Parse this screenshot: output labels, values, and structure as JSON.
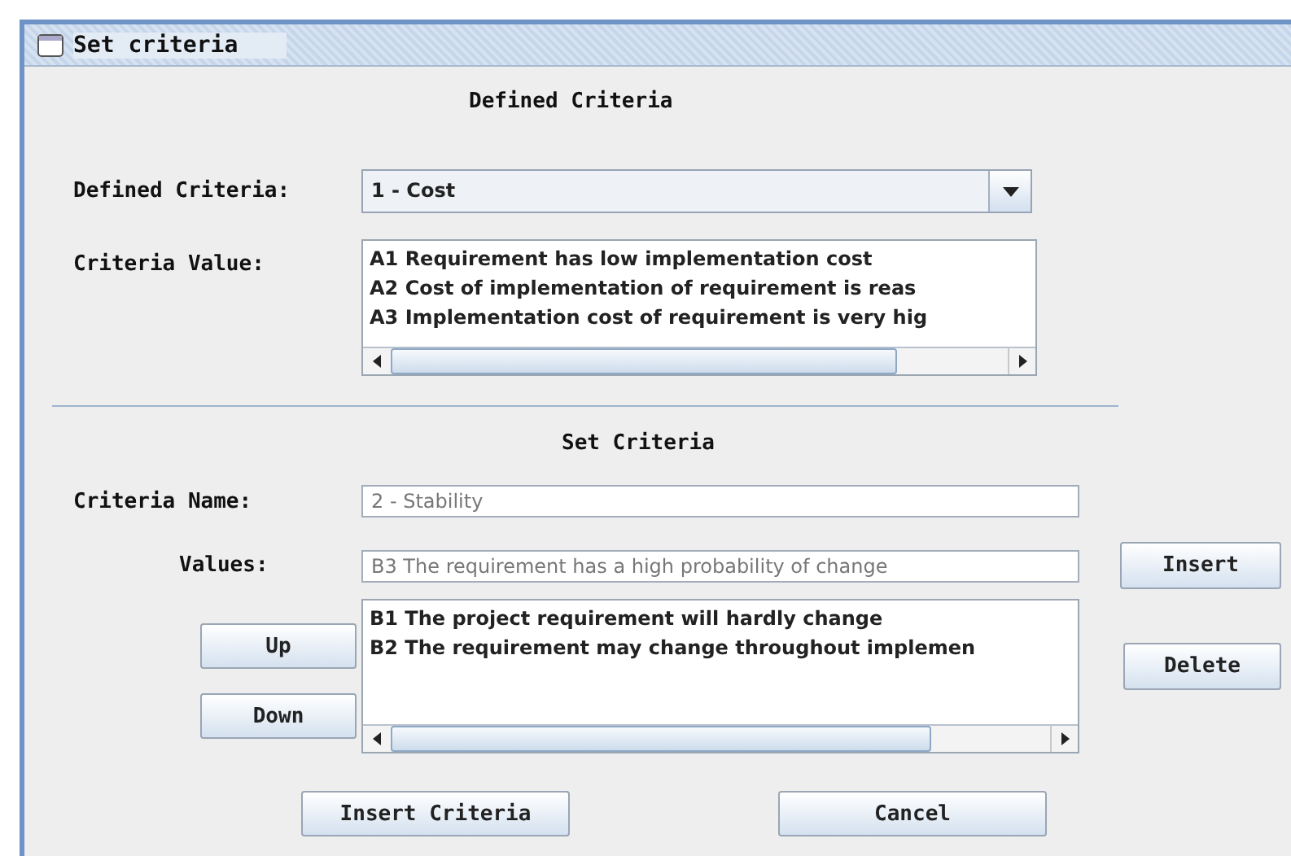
{
  "window": {
    "title": "Set criteria"
  },
  "defined_section": {
    "heading": "Defined Criteria",
    "criteria_label": "Defined Criteria:",
    "criteria_select": {
      "value": "1 - Cost"
    },
    "value_label": "Criteria Value:",
    "values": [
      "A1 Requirement has low implementation cost",
      "A2 Cost of implementation of requirement is reas",
      "A3 Implementation cost of requirement is very hig"
    ]
  },
  "set_section": {
    "heading": "Set Criteria",
    "name_label": "Criteria Name:",
    "name_field": {
      "value": "2 - Stability"
    },
    "values_label": "Values:",
    "values_field": {
      "value": "B3 The requirement has a high probability of change"
    },
    "values_list": [
      "B1 The project requirement will hardly change",
      "B2 The requirement may change throughout implemen"
    ]
  },
  "buttons": {
    "insert": "Insert",
    "up": "Up",
    "down": "Down",
    "delete": "Delete",
    "insert_criteria": "Insert Criteria",
    "cancel": "Cancel"
  }
}
